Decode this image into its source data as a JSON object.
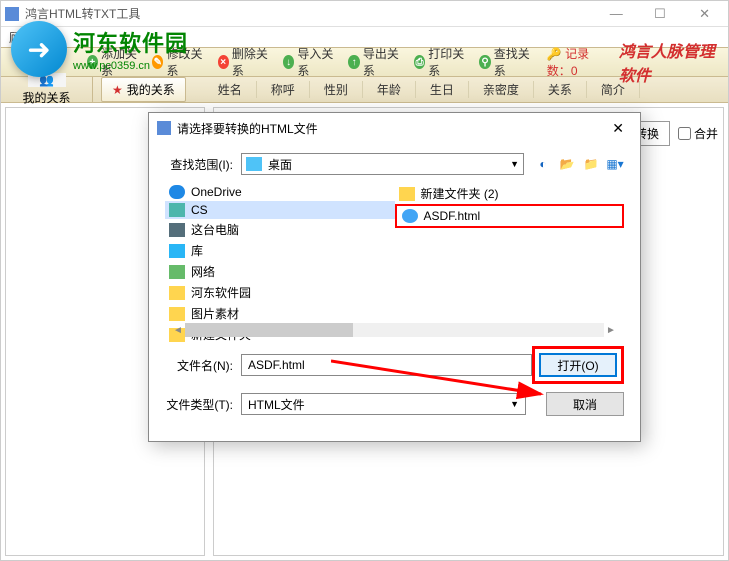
{
  "main": {
    "title": "鸿言HTML转TXT工具",
    "menu_customer": "顾客"
  },
  "watermark": {
    "name": "河东软件园",
    "url": "www.pc0359.cn"
  },
  "toolbar": {
    "add": "添加关系",
    "edit": "修改关系",
    "del": "删除关系",
    "import": "导入关系",
    "export": "导出关系",
    "print": "打印关系",
    "search": "查找关系",
    "record_label": "记录数：",
    "record_count": "0",
    "brand": "鸿言人脉管理软件"
  },
  "sidebar": {
    "my_relation": "我的关系"
  },
  "tab": {
    "my_relation": "我的关系"
  },
  "columns": {
    "name": "姓名",
    "title": "称呼",
    "gender": "性别",
    "age": "年龄",
    "birthday": "生日",
    "intimacy": "亲密度",
    "relation": "关系",
    "intro": "简介"
  },
  "right_panel": {
    "start_convert": "开始转换",
    "merge": "合并"
  },
  "dialog": {
    "title": "请选择要转换的HTML文件",
    "lookin_label": "查找范围(I):",
    "lookin_value": "桌面",
    "files_left": [
      {
        "icon": "cloud",
        "name": "OneDrive"
      },
      {
        "icon": "monitor",
        "name": "CS",
        "sel": true
      },
      {
        "icon": "pc",
        "name": "这台电脑"
      },
      {
        "icon": "lib",
        "name": "库"
      },
      {
        "icon": "net",
        "name": "网络"
      },
      {
        "icon": "folder",
        "name": "河东软件园"
      },
      {
        "icon": "folder",
        "name": "图片素材"
      },
      {
        "icon": "folder",
        "name": "新建文件夹"
      }
    ],
    "files_right": [
      {
        "icon": "folder",
        "name": "新建文件夹 (2)"
      },
      {
        "icon": "html",
        "name": "ASDF.html",
        "hl": true
      }
    ],
    "filename_label": "文件名(N):",
    "filename_value": "ASDF.html",
    "filetype_label": "文件类型(T):",
    "filetype_value": "HTML文件",
    "open_btn": "打开(O)",
    "cancel_btn": "取消"
  }
}
